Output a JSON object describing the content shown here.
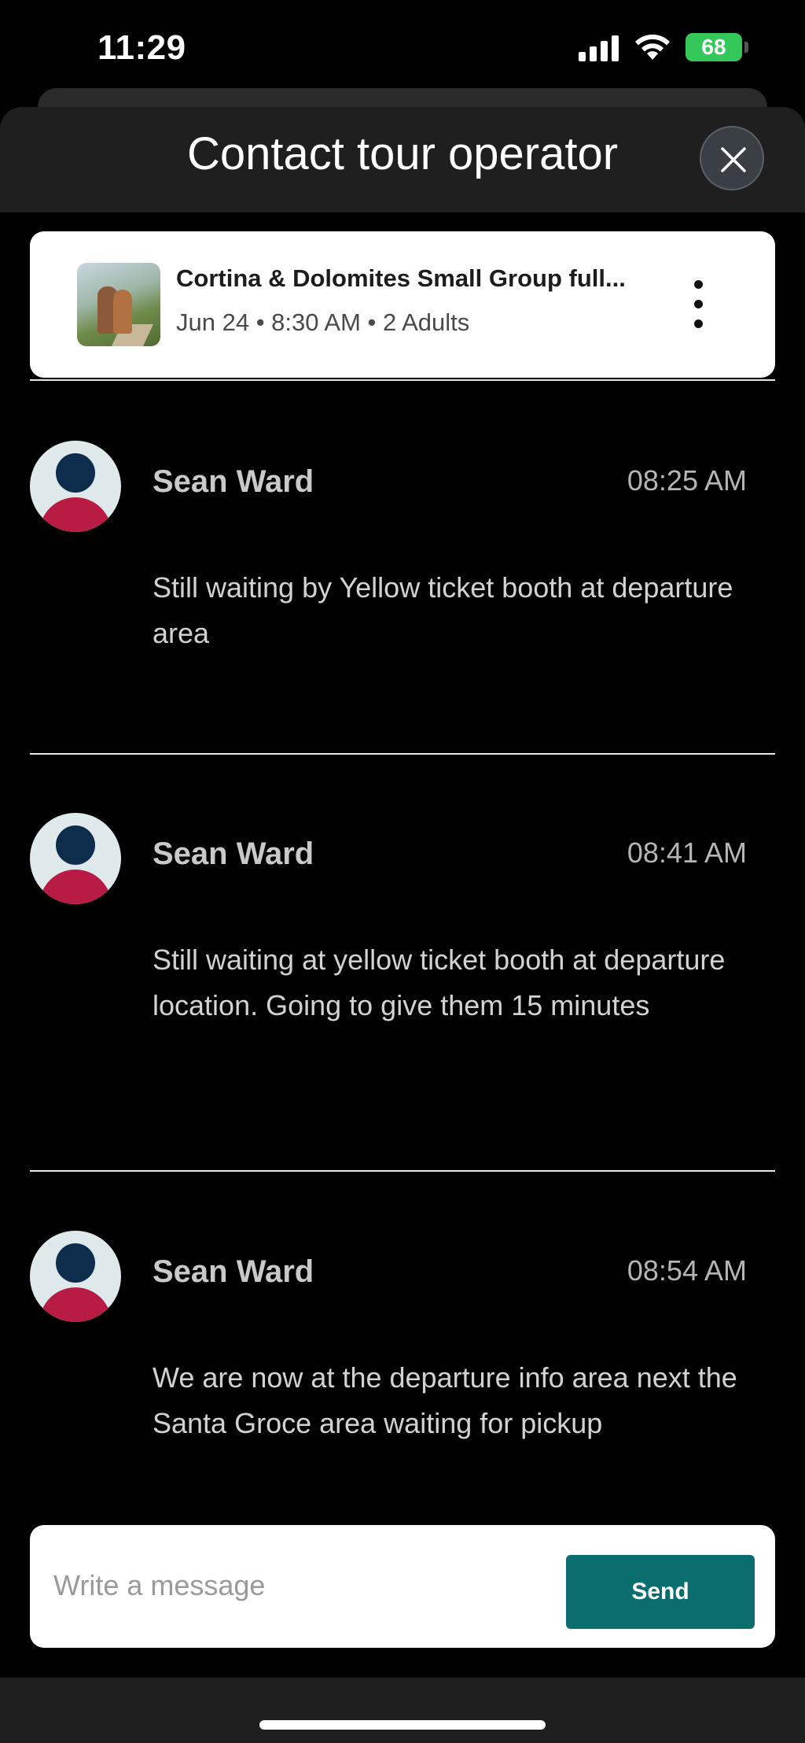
{
  "status_bar": {
    "time": "11:29",
    "battery": "68",
    "icons": [
      "signal-icon",
      "wifi-icon",
      "battery-charging-icon"
    ]
  },
  "header": {
    "title": "Contact tour operator",
    "close_icon": "close-icon"
  },
  "booking": {
    "title": "Cortina & Dolomites Small Group full...",
    "details": "Jun 24 • 8:30 AM • 2 Adults",
    "more_icon": "more-vertical-icon"
  },
  "messages": [
    {
      "sender": "Sean Ward",
      "time": "08:25 AM",
      "text": "Still waiting by Yellow ticket booth at departure area"
    },
    {
      "sender": "Sean Ward",
      "time": "08:41 AM",
      "text": "Still waiting at yellow ticket booth at departure location. Going to give them 15 minutes"
    },
    {
      "sender": "Sean Ward",
      "time": "08:54 AM",
      "text": "We are now at the departure info area next the Santa Groce area waiting for pickup"
    }
  ],
  "composer": {
    "placeholder": "Write a message",
    "send_label": "Send"
  },
  "colors": {
    "send_button": "#0b6e6e",
    "avatar_head": "#0e2d4c",
    "avatar_body": "#b81c45",
    "battery": "#34c759"
  }
}
